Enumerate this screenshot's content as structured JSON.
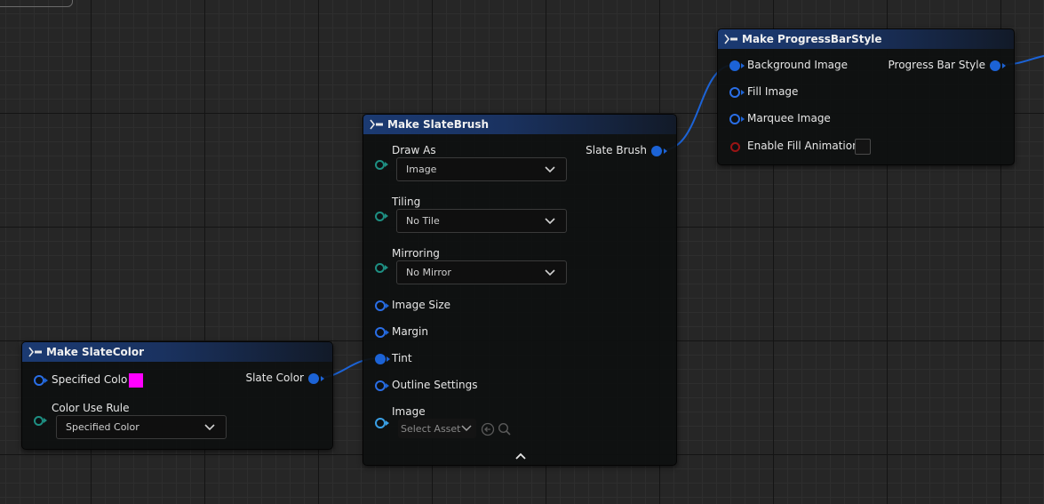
{
  "colors": {
    "header_blue": "#1b3a72",
    "pin_blue": "#1c63d6",
    "pin_teal": "#1e8f82",
    "pin_red": "#9a1414",
    "specified_color": "#ff00ff",
    "wire": "#1c63d6"
  },
  "icons": {
    "node_header": "make-struct-icon",
    "dropdown": "chevron-down-icon",
    "asset_use": "arrow-left-circle-icon",
    "asset_browse": "search-icon",
    "advanced_toggle": "chevron-up-icon"
  },
  "progressbar_node": {
    "title": "Make ProgressBarStyle",
    "inputs": [
      "Background Image",
      "Fill Image",
      "Marquee Image",
      "Enable Fill Animation"
    ],
    "output": "Progress Bar Style"
  },
  "slatebrush_node": {
    "title": "Make SlateBrush",
    "output": "Slate Brush",
    "draw_as": {
      "label": "Draw As",
      "value": "Image"
    },
    "tiling": {
      "label": "Tiling",
      "value": "No Tile"
    },
    "mirroring": {
      "label": "Mirroring",
      "value": "No Mirror"
    },
    "image_size": "Image Size",
    "margin": "Margin",
    "tint": "Tint",
    "outline_settings": "Outline Settings",
    "image": {
      "label": "Image",
      "value": "Select Asset"
    }
  },
  "slatecolor_node": {
    "title": "Make SlateColor",
    "specified_color": "Specified Color",
    "output": "Slate Color",
    "color_use_rule": {
      "label": "Color Use Rule",
      "value": "Specified Color"
    }
  }
}
